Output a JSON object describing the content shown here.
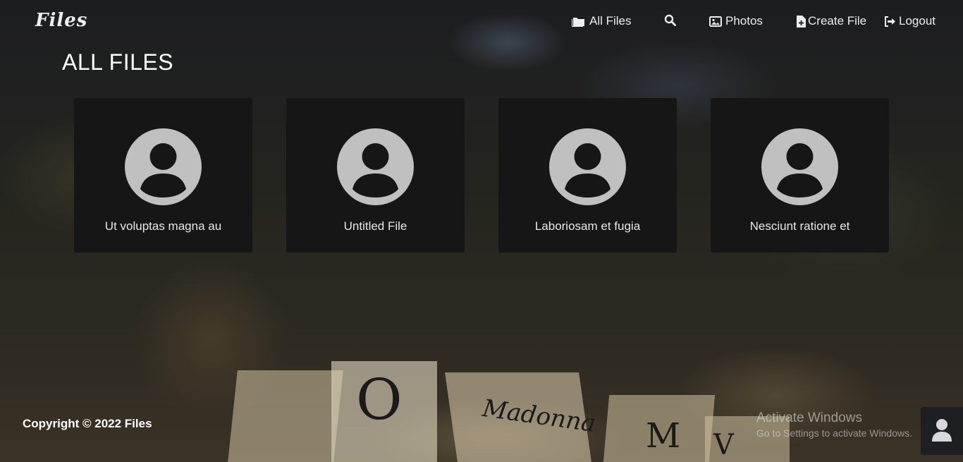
{
  "brand": "Files",
  "nav": {
    "all_files": "All Files",
    "search_icon": "search-icon",
    "photos": "Photos",
    "create_file": "Create File",
    "logout": "Logout"
  },
  "page_title": "ALL FILES",
  "files": [
    {
      "title": "Ut voluptas magna au",
      "icon": "user-avatar-icon"
    },
    {
      "title": "Untitled File",
      "icon": "user-avatar-icon"
    },
    {
      "title": "Laboriosam et fugia",
      "icon": "user-avatar-icon"
    },
    {
      "title": "Nesciunt ratione et",
      "icon": "user-avatar-icon"
    }
  ],
  "footer": {
    "copyright": "Copyright © 2022 Files"
  },
  "watermark": {
    "title": "Activate Windows",
    "subtitle": "Go to Settings to activate Windows."
  },
  "background": {
    "letters": [
      "O",
      "Madonna",
      "M",
      "V"
    ]
  },
  "colors": {
    "card_bg": "#161616",
    "avatar_gray": "#c0c0c0",
    "text": "#ffffff"
  }
}
